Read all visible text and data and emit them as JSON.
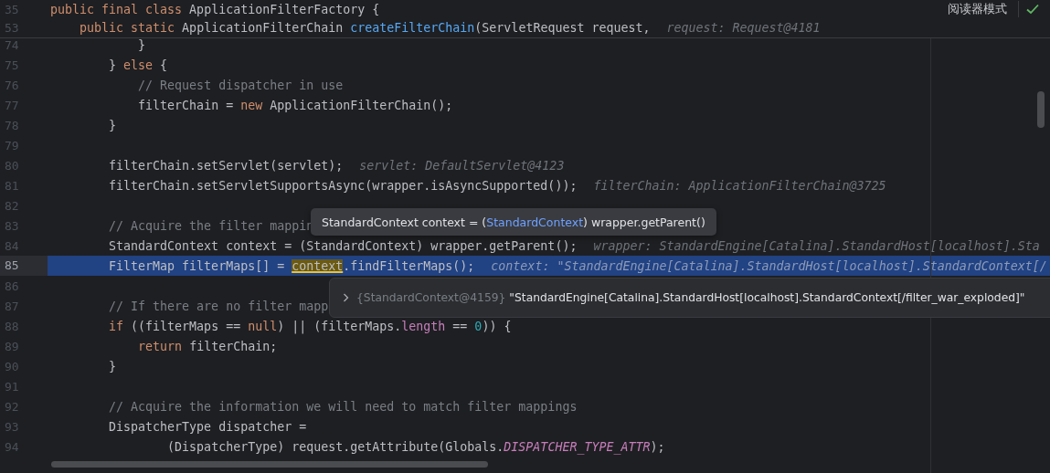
{
  "toolbar": {
    "reader_mode": "阅读器模式"
  },
  "header_lines": [
    {
      "number": "35",
      "segments": [
        {
          "kind": "keyword",
          "text": "public final class"
        },
        {
          "kind": "plain",
          "text": " ApplicationFilterFactory {"
        }
      ]
    },
    {
      "number": "53",
      "segments": [
        {
          "kind": "keyword",
          "text": "    public static"
        },
        {
          "kind": "plain",
          "text": " ApplicationFilterChain "
        },
        {
          "kind": "method",
          "text": "createFilterChain"
        },
        {
          "kind": "plain",
          "text": "(ServletRequest request,"
        }
      ],
      "hint": "request: Request@4181"
    }
  ],
  "lines": [
    {
      "number": "74",
      "current": false,
      "segments": [
        {
          "kind": "plain",
          "text": "            }"
        }
      ]
    },
    {
      "number": "75",
      "current": false,
      "segments": [
        {
          "kind": "plain",
          "text": "        } "
        },
        {
          "kind": "keyword",
          "text": "else"
        },
        {
          "kind": "plain",
          "text": " {"
        }
      ]
    },
    {
      "number": "76",
      "current": false,
      "segments": [
        {
          "kind": "comment",
          "text": "            // Request dispatcher in use"
        }
      ]
    },
    {
      "number": "77",
      "current": false,
      "segments": [
        {
          "kind": "plain",
          "text": "            filterChain = "
        },
        {
          "kind": "keyword",
          "text": "new"
        },
        {
          "kind": "plain",
          "text": " ApplicationFilterChain();"
        }
      ]
    },
    {
      "number": "78",
      "current": false,
      "segments": [
        {
          "kind": "plain",
          "text": "        }"
        }
      ]
    },
    {
      "number": "79",
      "current": false
    },
    {
      "number": "80",
      "current": false,
      "segments": [
        {
          "kind": "plain",
          "text": "        filterChain.setServlet(servlet);"
        }
      ],
      "hint": "servlet: DefaultServlet@4123"
    },
    {
      "number": "81",
      "current": false,
      "segments": [
        {
          "kind": "plain",
          "text": "        filterChain.setServletSupportsAsync(wrapper.isAsyncSupported());"
        }
      ],
      "hint": "filterChain: ApplicationFilterChain@3725"
    },
    {
      "number": "82",
      "current": false
    },
    {
      "number": "83",
      "current": false,
      "segments": [
        {
          "kind": "comment",
          "text": "        // Acquire the filter mappin"
        }
      ]
    },
    {
      "number": "84",
      "current": false,
      "segments": [
        {
          "kind": "plain",
          "text": "        StandardContext context = (StandardContext) wrapper.getParent();"
        }
      ],
      "hint": "wrapper: StandardEngine[Catalina].StandardHost[localhost].Sta"
    },
    {
      "number": "85",
      "current": true,
      "segments": [
        {
          "kind": "plain",
          "text": "        FilterMap filterMaps[] = "
        },
        {
          "kind": "reference",
          "text": "context"
        },
        {
          "kind": "plain",
          "text": ".findFilterMaps();"
        }
      ],
      "hint": "context: \"StandardEngine[Catalina].StandardHost[localhost].StandardContext[/"
    },
    {
      "number": "86",
      "current": false
    },
    {
      "number": "87",
      "current": false,
      "segments": [
        {
          "kind": "comment",
          "text": "        // If there are no filter mapp"
        }
      ]
    },
    {
      "number": "88",
      "current": false,
      "segments": [
        {
          "kind": "keyword",
          "text": "        if"
        },
        {
          "kind": "plain",
          "text": " ((filterMaps == "
        },
        {
          "kind": "keyword",
          "text": "null"
        },
        {
          "kind": "plain",
          "text": ") || (filterMaps."
        },
        {
          "kind": "field",
          "text": "length"
        },
        {
          "kind": "plain",
          "text": " == "
        },
        {
          "kind": "number",
          "text": "0"
        },
        {
          "kind": "plain",
          "text": ")) {"
        }
      ]
    },
    {
      "number": "89",
      "current": false,
      "segments": [
        {
          "kind": "keyword",
          "text": "            return"
        },
        {
          "kind": "plain",
          "text": " filterChain;"
        }
      ]
    },
    {
      "number": "90",
      "current": false,
      "segments": [
        {
          "kind": "plain",
          "text": "        }"
        }
      ]
    },
    {
      "number": "91",
      "current": false
    },
    {
      "number": "92",
      "current": false,
      "segments": [
        {
          "kind": "comment",
          "text": "        // Acquire the information we will need to match filter mappings"
        }
      ]
    },
    {
      "number": "93",
      "current": false,
      "segments": [
        {
          "kind": "plain",
          "text": "        DispatcherType dispatcher ="
        }
      ]
    },
    {
      "number": "94",
      "current": false,
      "segments": [
        {
          "kind": "plain",
          "text": "                (DispatcherType) request.getAttribute(Globals."
        },
        {
          "kind": "constant",
          "text": "DISPATCHER_TYPE_ATTR"
        },
        {
          "kind": "plain",
          "text": ");"
        }
      ]
    }
  ],
  "tooltip": {
    "segments": [
      {
        "kind": "plain",
        "text": "StandardContext context = ("
      },
      {
        "kind": "type",
        "text": "StandardContext"
      },
      {
        "kind": "plain",
        "text": ") wrapper.getParent()"
      }
    ]
  },
  "value_popup": {
    "object_id": "{StandardContext@4159}",
    "value": "\"StandardEngine[Catalina].StandardHost[localhost].StandardContext[/filter_war_exploded]\""
  }
}
